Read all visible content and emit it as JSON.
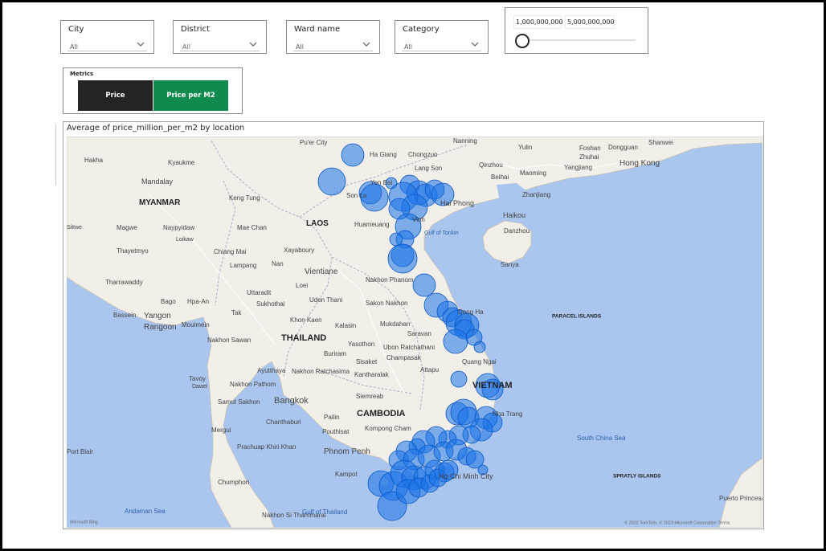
{
  "filters": {
    "city": {
      "label": "City",
      "value": "All"
    },
    "district": {
      "label": "District",
      "value": "All"
    },
    "ward": {
      "label": "Ward name",
      "value": "All"
    },
    "category": {
      "label": "Category",
      "value": "All"
    }
  },
  "price_range": {
    "min": "1,000,000,000",
    "max": "5,000,000,000",
    "slider_position": 0.0
  },
  "metrics": {
    "title": "Metrics",
    "buttons": [
      {
        "label": "Price",
        "color": "#252423",
        "selected": true
      },
      {
        "label": "Price per M2",
        "color": "#0f8b4f",
        "selected": false
      }
    ]
  },
  "map": {
    "title": "Average of price_million_per_m2 by location",
    "bubble_color": "#1a73e8",
    "land_color": "#f2efe9",
    "water_color": "#aac6ee",
    "labels": {
      "pu_er": "Pu'er City",
      "hakha": "Hakha",
      "kyaukme": "Kyaukme",
      "mandalay": "Mandalay",
      "myanmar": "MYANMAR",
      "keng_tung": "Keng Tung",
      "sittwe": "Sittwe",
      "magwe": "Magwe",
      "naypyidaw": "Naypyidaw",
      "mae_chan": "Mae Chan",
      "laos": "LAOS",
      "loikaw": "Loikaw",
      "thayetmyo": "Thayetmyo",
      "chiang_mai": "Chiang Mai",
      "xayaboury": "Xayaboury",
      "lampang": "Lampang",
      "nan": "Nan",
      "vientiane": "Vientiane",
      "tharrawaddy": "Tharrawaddy",
      "loei": "Loei",
      "uttaradit": "Uttaradit",
      "bago": "Bago",
      "hpa_an": "Hpa-An",
      "sukhothai": "Sukhothai",
      "udon_thani": "Udon Thani",
      "bassein": "Bassein",
      "yangon": "Yangon",
      "rangoon": "Rangoon",
      "moulmein": "Moulmein",
      "tak": "Tak",
      "khon_kaen": "Khon Kaen",
      "kalasin": "Kalasin",
      "thailand": "THAILAND",
      "nakhon_sawan": "Nakhon Sawan",
      "yasothon": "Yasothon",
      "buriram": "Buriram",
      "sisaket": "Sisaket",
      "nakhon_ratchasima": "Nakhon Ratchasima",
      "ayutthaya": "Ayutthaya",
      "tavoy": "Tavoy",
      "dawei": "Dawei",
      "nakhon_pathom": "Nakhon Pathom",
      "bangkok": "Bangkok",
      "samut_sakhon": "Samut Sakhon",
      "chanthaburi": "Chanthaburi",
      "mergui": "Mergui",
      "prachuap": "Prachuap Khiri Khan",
      "chumphon": "Chumphon",
      "andaman": "Andaman Sea",
      "nakhon_si": "Nakhon Si Thammarat",
      "port_blair": "Port Blair",
      "ha_giang": "Ha Giang",
      "chongzuo": "Chongzuo",
      "lang_son": "Lang Son",
      "hai_phong": "Hai Phong",
      "yen_bai": "Yen Bai",
      "son_la": "Son La",
      "huameuang": "Huameuang",
      "vinh": "Vinh",
      "gulf_tonkin": "Gulf of Tonkin",
      "nakhon_phanom": "Nakhon Phanom",
      "sakon_nakhon": "Sakon Nakhon",
      "mukdahan": "Mukdahan",
      "saravan": "Saravan",
      "ubon": "Ubon Ratchathani",
      "champasak": "Champasak",
      "attapu": "Attapu",
      "kantharalak": "Kantharalak",
      "quang_ngai": "Quang Ngai",
      "dong_ha": "Dong Ha",
      "siemreab": "Siemreab",
      "cambodia": "CAMBODIA",
      "pailin": "Pailin",
      "pouthisat": "Pouthisat",
      "kompong_cham": "Kompong Cham",
      "phnom_penh": "Phnom Penh",
      "kampot": "Kampot",
      "gulf_thailand": "Gulf of Thailand",
      "vietnam": "VIETNAM",
      "nha_trang": "Nha Trang",
      "ho_chi_minh": "Ho Chi Minh City",
      "nanning": "Nanning",
      "yulin": "Yulin",
      "qinzhou": "Qinzhou",
      "foshan": "Foshan",
      "zhuhai": "Zhuhai",
      "dongguan": "Dongguan",
      "shanwei": "Shanwei",
      "hong_kong": "Hong Kong",
      "yangjiang": "Yangjiang",
      "maoming": "Maoming",
      "beihai": "Beihai",
      "zhanjiang": "Zhanjiang",
      "haikou": "Haikou",
      "danzhou": "Danzhou",
      "sanya": "Sanya",
      "paracel": "PARACEL ISLANDS",
      "south_china_sea": "South China Sea",
      "spratly": "SPRATLY ISLANDS",
      "puerto_princesa": "Puerto Princesa",
      "attribution": "© 2022 TomTom, © 2023 Microsoft Corporation  Terms",
      "bing": "Microsoft Bing"
    }
  }
}
